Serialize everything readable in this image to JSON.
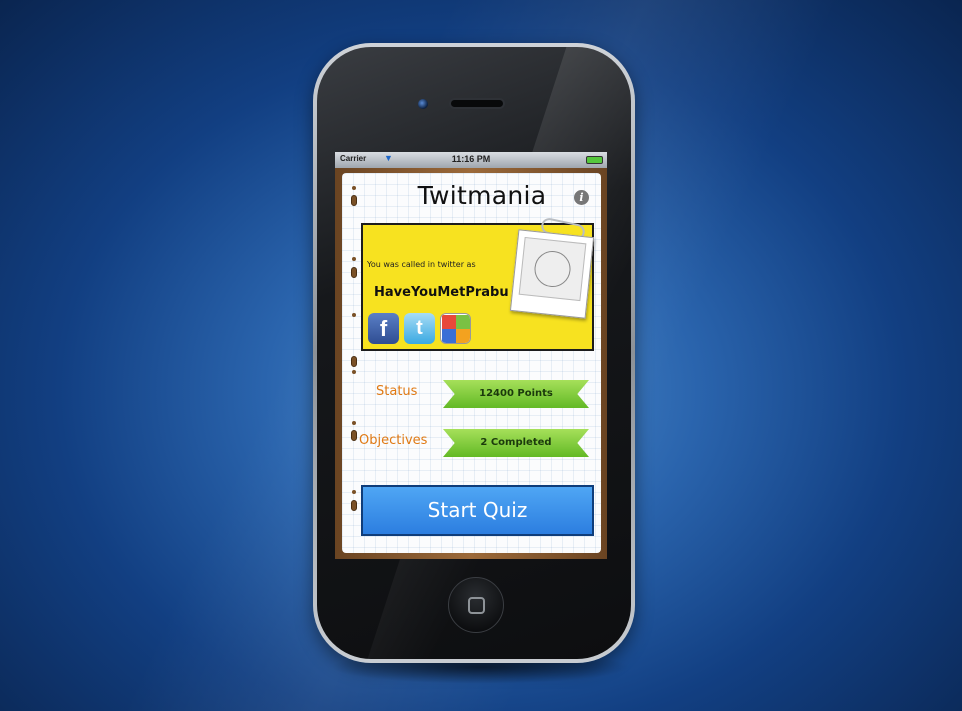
{
  "status_bar": {
    "carrier": "Carrier",
    "time": "11:16 PM",
    "wifi_icon": "wifi-icon",
    "battery_icon": "battery-icon"
  },
  "app": {
    "title": "Twitmania",
    "info_icon": "info-icon"
  },
  "profile": {
    "called_text": "You was called in twitter as",
    "username": "HaveYouMetPrabu",
    "social_buttons": [
      {
        "name": "facebook",
        "glyph": "f"
      },
      {
        "name": "twitter",
        "glyph": "t"
      },
      {
        "name": "game-center",
        "glyph": ""
      }
    ]
  },
  "stats": {
    "status_label": "Status",
    "status_value": "12400 Points",
    "objectives_label": "Objectives",
    "objectives_value": "2 Completed"
  },
  "actions": {
    "start_quiz_label": "Start Quiz"
  },
  "colors": {
    "card_yellow": "#f7e220",
    "label_orange": "#e07a14",
    "ribbon_green": "#62b925",
    "button_blue": "#2c7ee0"
  }
}
